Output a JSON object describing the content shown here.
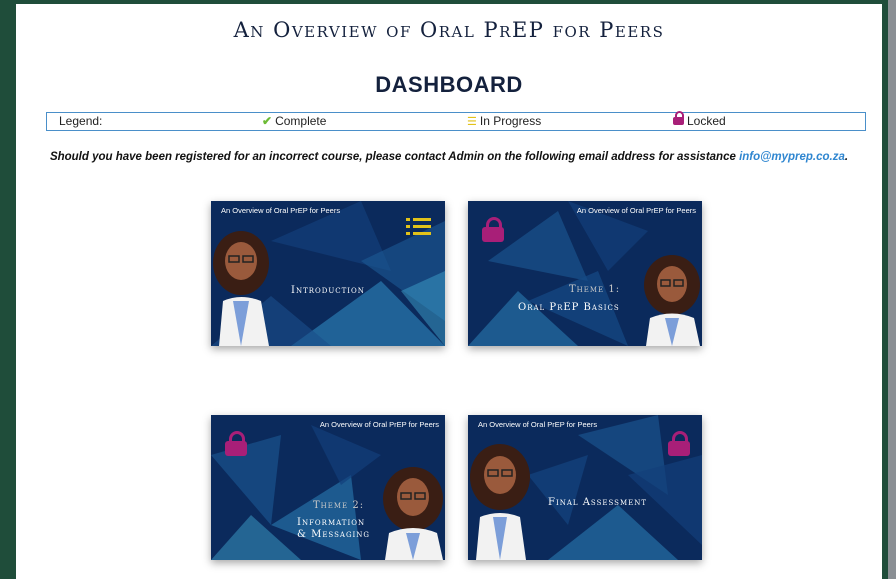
{
  "course_title": "An Overview of Oral PrEP for Peers",
  "dashboard_title": "DASHBOARD",
  "legend": {
    "label": "Legend:",
    "complete": "Complete",
    "in_progress": "In Progress",
    "locked": "Locked"
  },
  "notice": {
    "text": "Should you have been registered for an incorrect course, please contact Admin on the following email address for assistance ",
    "email": "info@myprep.co.za",
    "suffix": "."
  },
  "colors": {
    "complete": "#6dbb35",
    "in_progress": "#e2c21a",
    "locked": "#a81f78",
    "card_bg": "#0b2a5c"
  },
  "modules": [
    {
      "tag": "An Overview of Oral PrEP for Peers",
      "theme": "",
      "title": "Introduction",
      "status": "in-progress"
    },
    {
      "tag": "An Overview of Oral PrEP for Peers",
      "theme": "Theme 1:",
      "title": "Oral PrEP Basics",
      "status": "locked"
    },
    {
      "tag": "An Overview of Oral PrEP for Peers",
      "theme": "Theme 2:",
      "title": "Information",
      "title2": "& Messaging",
      "status": "locked"
    },
    {
      "tag": "An Overview of Oral PrEP for Peers",
      "theme": "",
      "title": "Final Assessment",
      "status": "locked"
    }
  ]
}
